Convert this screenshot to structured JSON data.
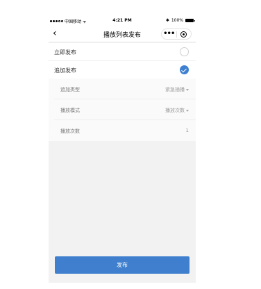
{
  "status_bar": {
    "carrier": "中国移动",
    "wifi_icon": "wifi-icon",
    "time": "4:21 PM",
    "bluetooth_icon": "bluetooth-icon",
    "battery_percent": "100%"
  },
  "nav": {
    "back_icon": "chevron-left-icon",
    "title": "播放列表发布",
    "more_icon": "more-dots-icon",
    "close_icon": "target-circle-icon"
  },
  "options": [
    {
      "label": "立即发布",
      "checked": false
    },
    {
      "label": "追加发布",
      "checked": true
    }
  ],
  "settings": [
    {
      "label": "追加类型",
      "value": "紧急插播",
      "dropdown": true
    },
    {
      "label": "播放模式",
      "value": "播放次数",
      "dropdown": true
    },
    {
      "label": "播放次数",
      "value": "1",
      "dropdown": false
    }
  ],
  "publish_button": "发布",
  "colors": {
    "accent": "#3f7fcd",
    "background": "#f2f2f2"
  }
}
